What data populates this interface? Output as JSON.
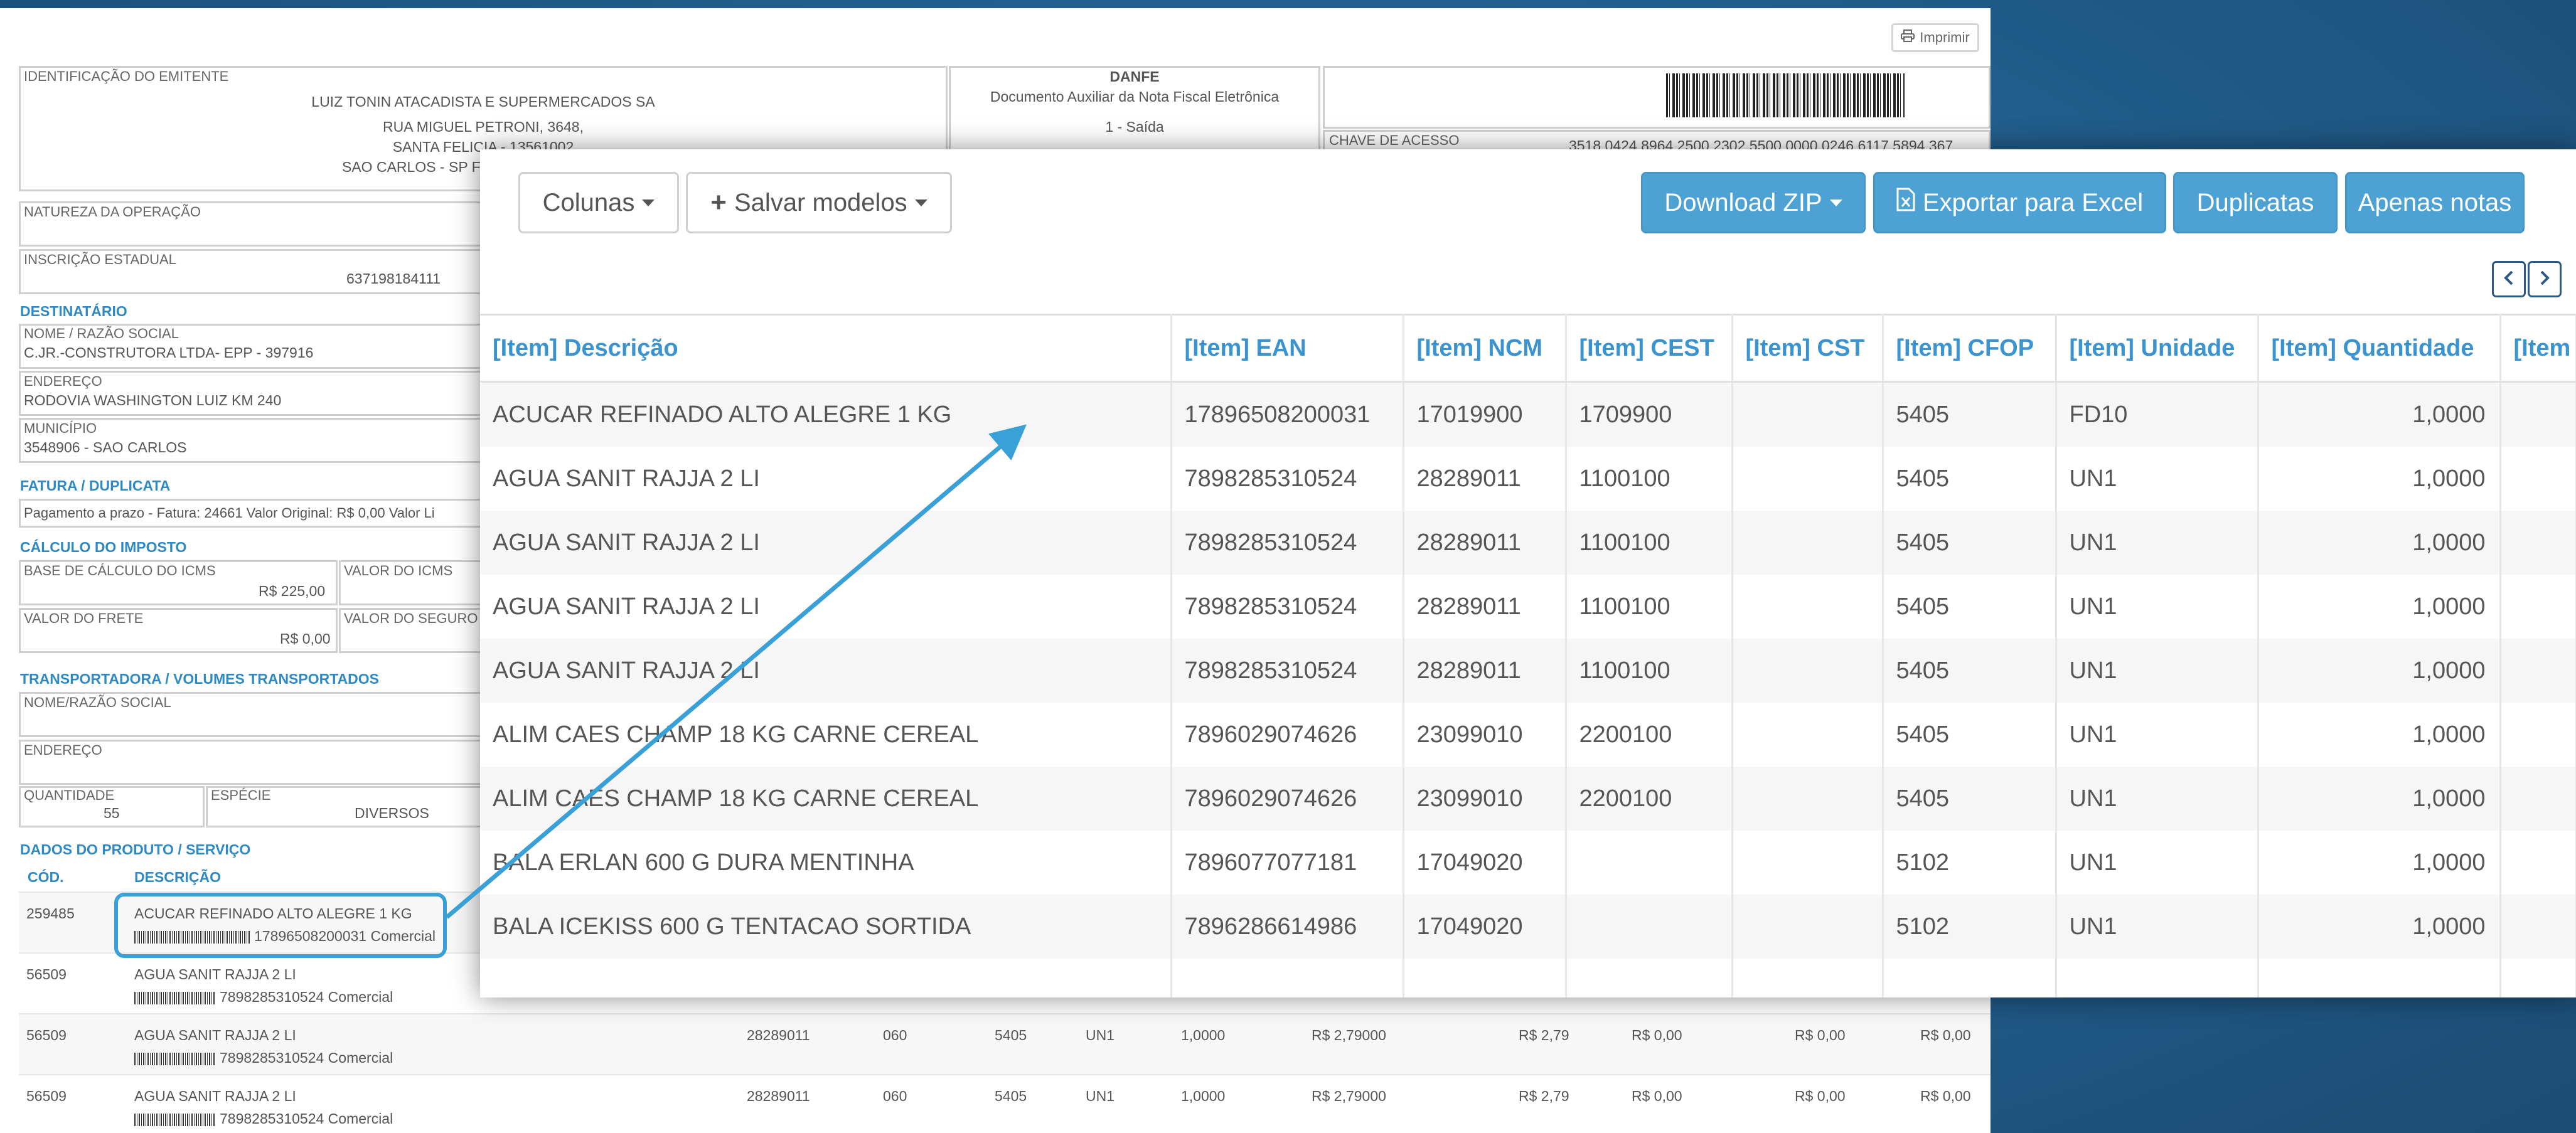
{
  "danfe": {
    "print_label": "Imprimir",
    "emitente_label": "IDENTIFICAÇÃO DO EMITENTE",
    "emitente_name": "LUIZ TONIN ATACADISTA E SUPERMERCADOS SA",
    "emitente_addr1": "RUA MIGUEL PETRONI, 3648,",
    "emitente_addr2": "SANTA FELICIA - 13561002",
    "emitente_addr3": "SAO CARLOS - SP F",
    "danfe_title": "DANFE",
    "danfe_sub": "Documento Auxiliar da Nota Fiscal Eletrônica",
    "danfe_tipo": "1 - Saída",
    "chave_label": "CHAVE DE ACESSO",
    "chave_value": "3518 0424 8964 2500 2302 5500 0000 0246 6117 5894 367",
    "natureza_label": "NATUREZA DA OPERAÇÃO",
    "inscricao_label": "INSCRIÇÃO ESTADUAL",
    "inscricao_value": "637198184111",
    "destinatario_title": "DESTINATÁRIO",
    "nome_label": "NOME / RAZÃO SOCIAL",
    "nome_value": "C.JR.-CONSTRUTORA LTDA- EPP - 397916",
    "endereco_label": "ENDEREÇO",
    "endereco_value": "RODOVIA WASHINGTON LUIZ KM 240",
    "municipio_label": "MUNICÍPIO",
    "municipio_value": "3548906 - SAO CARLOS",
    "fatura_title": "FATURA / DUPLICATA",
    "fatura_value": "Pagamento a prazo - Fatura: 24661 Valor Original: R$ 0,00 Valor Li",
    "calculo_title": "CÁLCULO DO IMPOSTO",
    "base_icms_label": "BASE DE CÁLCULO DO ICMS",
    "base_icms_value": "R$ 225,00",
    "valor_icms_label": "VALOR DO ICMS",
    "frete_label": "VALOR DO FRETE",
    "frete_value": "R$ 0,00",
    "seguro_label": "VALOR DO SEGURO",
    "transp_title": "TRANSPORTADORA / VOLUMES TRANSPORTADOS",
    "transp_nome_label": "NOME/RAZÃO SOCIAL",
    "transp_end_label": "ENDEREÇO",
    "qtd_label": "QUANTIDADE",
    "qtd_value": "55",
    "especie_label": "ESPÉCIE",
    "especie_value": "DIVERSOS",
    "produtos_title": "DADOS DO PRODUTO / SERVIÇO",
    "col_cod": "CÓD.",
    "col_desc": "DESCRIÇÃO",
    "products": [
      {
        "cod": "259485",
        "desc": "ACUCAR REFINADO ALTO ALEGRE 1 KG",
        "ean": "17896508200031 Comercial"
      },
      {
        "cod": "56509",
        "desc": "AGUA SANIT RAJJA 2 LI",
        "ean": "7898285310524 Comercial"
      },
      {
        "cod": "56509",
        "desc": "AGUA SANIT RAJJA 2 LI",
        "ean": "7898285310524 Comercial",
        "ncm": "28289011",
        "cst": "060",
        "cfop": "5405",
        "un": "UN1",
        "qtd": "1,0000",
        "vunit": "R$ 2,79000",
        "vtot": "R$ 2,79",
        "c1": "R$ 0,00",
        "c2": "R$ 0,00",
        "c3": "R$ 0,00"
      },
      {
        "cod": "56509",
        "desc": "AGUA SANIT RAJJA 2 LI",
        "ean": "7898285310524 Comercial",
        "ncm": "28289011",
        "cst": "060",
        "cfop": "5405",
        "un": "UN1",
        "qtd": "1,0000",
        "vunit": "R$ 2,79000",
        "vtot": "R$ 2,79",
        "c1": "R$ 0,00",
        "c2": "R$ 0,00",
        "c3": "R$ 0,00"
      }
    ]
  },
  "panel": {
    "toolbar": {
      "colunas": "Colunas",
      "salvar": "Salvar modelos",
      "download": "Download ZIP",
      "exportar": "Exportar para Excel",
      "duplicatas": "Duplicatas",
      "apenas": "Apenas notas"
    },
    "columns": [
      "[Item] Descrição",
      "[Item] EAN",
      "[Item] NCM",
      "[Item] CEST",
      "[Item] CST",
      "[Item] CFOP",
      "[Item] Unidade",
      "[Item] Quantidade",
      "[Item"
    ],
    "rows": [
      [
        "ACUCAR REFINADO ALTO ALEGRE 1 KG",
        "17896508200031",
        "17019900",
        "1709900",
        "",
        "5405",
        "FD10",
        "1,0000"
      ],
      [
        "AGUA SANIT RAJJA 2 LI",
        "7898285310524",
        "28289011",
        "1100100",
        "",
        "5405",
        "UN1",
        "1,0000"
      ],
      [
        "AGUA SANIT RAJJA 2 LI",
        "7898285310524",
        "28289011",
        "1100100",
        "",
        "5405",
        "UN1",
        "1,0000"
      ],
      [
        "AGUA SANIT RAJJA 2 LI",
        "7898285310524",
        "28289011",
        "1100100",
        "",
        "5405",
        "UN1",
        "1,0000"
      ],
      [
        "AGUA SANIT RAJJA 2 LI",
        "7898285310524",
        "28289011",
        "1100100",
        "",
        "5405",
        "UN1",
        "1,0000"
      ],
      [
        "ALIM CAES CHAMP 18 KG CARNE CEREAL",
        "7896029074626",
        "23099010",
        "2200100",
        "",
        "5405",
        "UN1",
        "1,0000"
      ],
      [
        "ALIM CAES CHAMP 18 KG CARNE CEREAL",
        "7896029074626",
        "23099010",
        "2200100",
        "",
        "5405",
        "UN1",
        "1,0000"
      ],
      [
        "BALA ERLAN 600 G DURA MENTINHA",
        "7896077077181",
        "17049020",
        "",
        "",
        "5102",
        "UN1",
        "1,0000"
      ],
      [
        "BALA ICEKISS 600 G TENTACAO SORTIDA",
        "7896286614986",
        "17049020",
        "",
        "",
        "5102",
        "UN1",
        "1,0000"
      ]
    ]
  },
  "colors": {
    "accent": "#4da2d3",
    "header_text": "#3b93cf",
    "highlight": "#3aa0d8"
  }
}
